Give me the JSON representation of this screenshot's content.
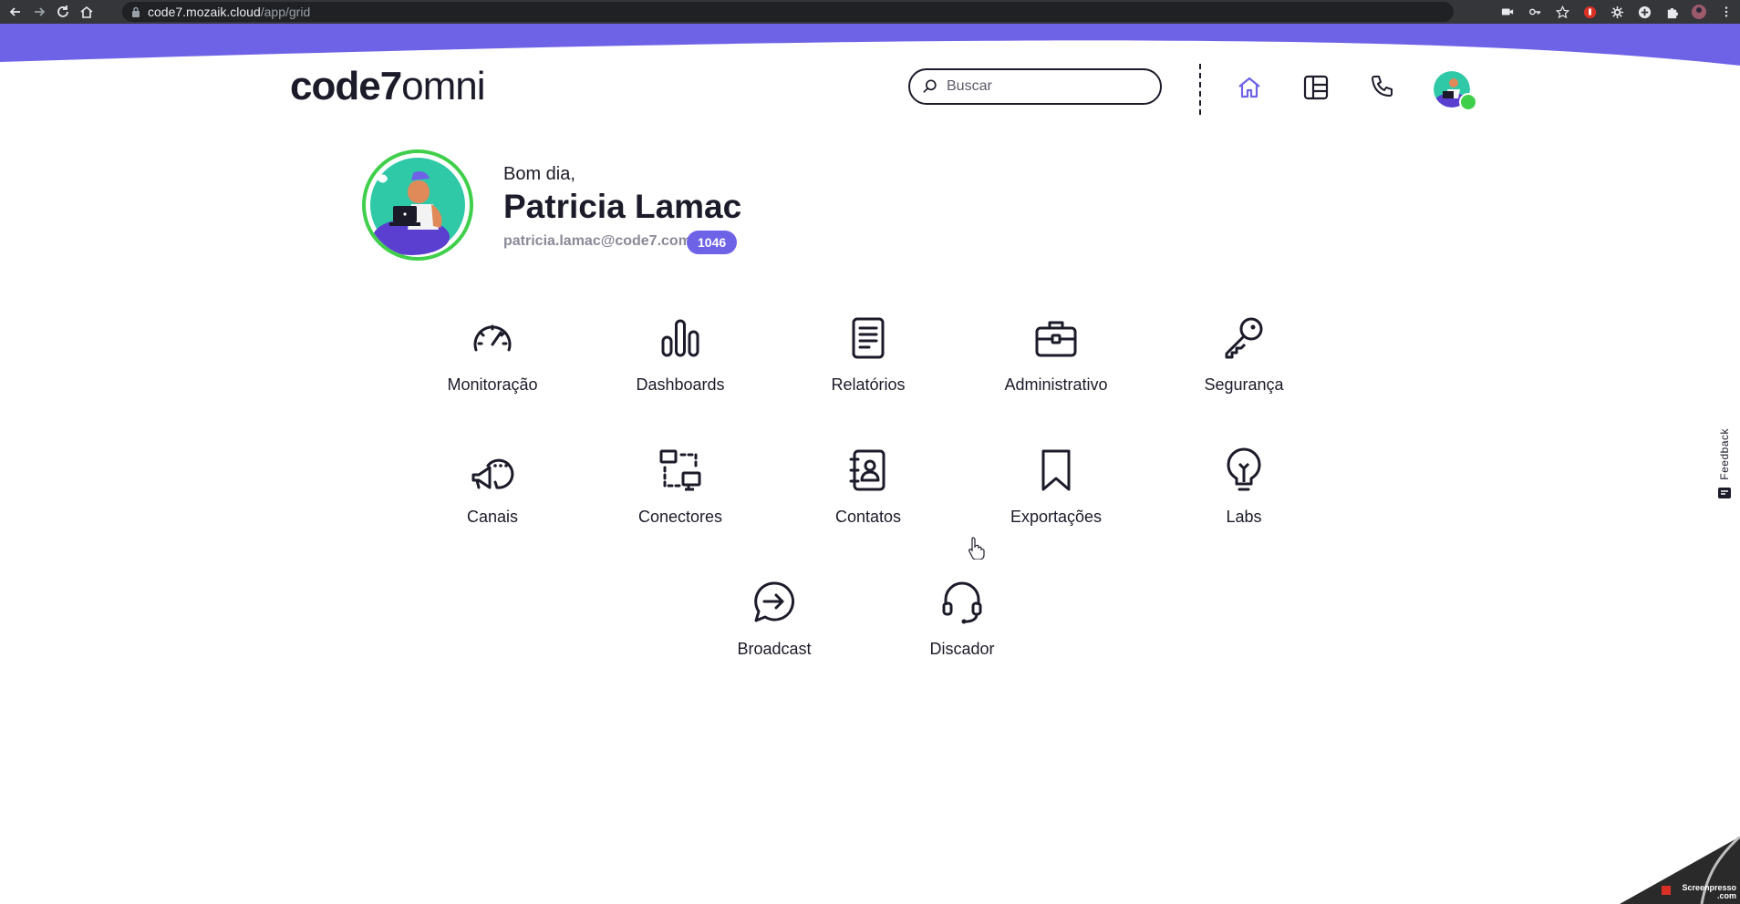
{
  "browser": {
    "url_host": "code7.mozaik.cloud",
    "url_path": "/app/grid"
  },
  "header": {
    "logo_bold": "code7",
    "logo_light": "omni",
    "search_placeholder": "Buscar"
  },
  "profile": {
    "greeting": "Bom dia,",
    "name": "Patricia Lamac",
    "email": "patricia.lamac@code7.com",
    "extension": "1046"
  },
  "apps": [
    {
      "label": "Monitoração",
      "icon": "speedometer-icon"
    },
    {
      "label": "Dashboards",
      "icon": "bar-chart-icon"
    },
    {
      "label": "Relatórios",
      "icon": "document-icon"
    },
    {
      "label": "Administrativo",
      "icon": "briefcase-icon"
    },
    {
      "label": "Segurança",
      "icon": "key-icon"
    },
    {
      "label": "Canais",
      "icon": "megaphone-chat-icon"
    },
    {
      "label": "Conectores",
      "icon": "connector-icon"
    },
    {
      "label": "Contatos",
      "icon": "contact-book-icon"
    },
    {
      "label": "Exportações",
      "icon": "bookmark-icon"
    },
    {
      "label": "Labs",
      "icon": "lightbulb-icon"
    },
    {
      "label": "Broadcast",
      "icon": "broadcast-bubble-icon"
    },
    {
      "label": "Discador",
      "icon": "headset-icon"
    }
  ],
  "feedback": {
    "label": "Feedback"
  },
  "watermark": {
    "line1": "Screenpresso",
    "line2": ".com"
  },
  "colors": {
    "accent": "#6e63e6",
    "status_online": "#3fcf4a",
    "avatar_ring": "#3fcf4a",
    "text_dark": "#1b1b2a",
    "text_muted": "#8a8a98"
  }
}
